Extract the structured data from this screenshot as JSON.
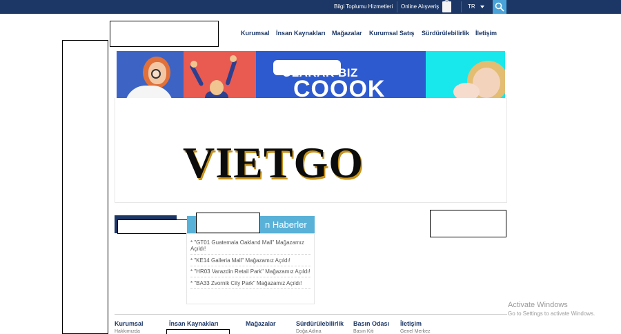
{
  "topbar": {
    "links": [
      "Bilgi Toplumu Hizmetleri",
      "Online Alışveriş"
    ],
    "language": "TR"
  },
  "nav": [
    "Kurumsal",
    "İnsan Kaynakları",
    "Mağazalar",
    "Kurumsal Satış",
    "Sürdürülebilirlik",
    "İletişim"
  ],
  "banner": {
    "line1": "OLARAK BIZ",
    "line2": "COOOK"
  },
  "brand_text": "VIETGO",
  "news": {
    "title": "n Haberler",
    "items": [
      "* \"GT01 Guatemala Oakland Mall\" Mağazamız Açıldı!",
      "* \"KE14 Galleria Mall\" Mağazamız Açıldı!",
      "* \"HR03 Varazdin Retail Park\" Mağazamız Açıldı!",
      "* \"BA33 Zvornik City Park\" Mağazamız Açıldı!"
    ]
  },
  "footer": {
    "columns": [
      {
        "heading": "Kurumsal",
        "sub": "Hakkımızda"
      },
      {
        "heading": "İnsan Kaynakları",
        "sub": ""
      },
      {
        "heading": "Mağazalar",
        "sub": ""
      },
      {
        "heading": "Sürdürülebilirlik",
        "sub": "Doğa Adına"
      },
      {
        "heading": "Basın Odası",
        "sub": "Basın Kiti"
      },
      {
        "heading": "İletişim",
        "sub": "Genel Merkez"
      }
    ]
  },
  "watermark": {
    "title": "Activate Windows",
    "subtitle": "Go to Settings to activate Windows."
  },
  "colors": {
    "navy": "#1c3766",
    "accent_blue": "#5ab1d8",
    "search_button": "#4aa3d8"
  }
}
